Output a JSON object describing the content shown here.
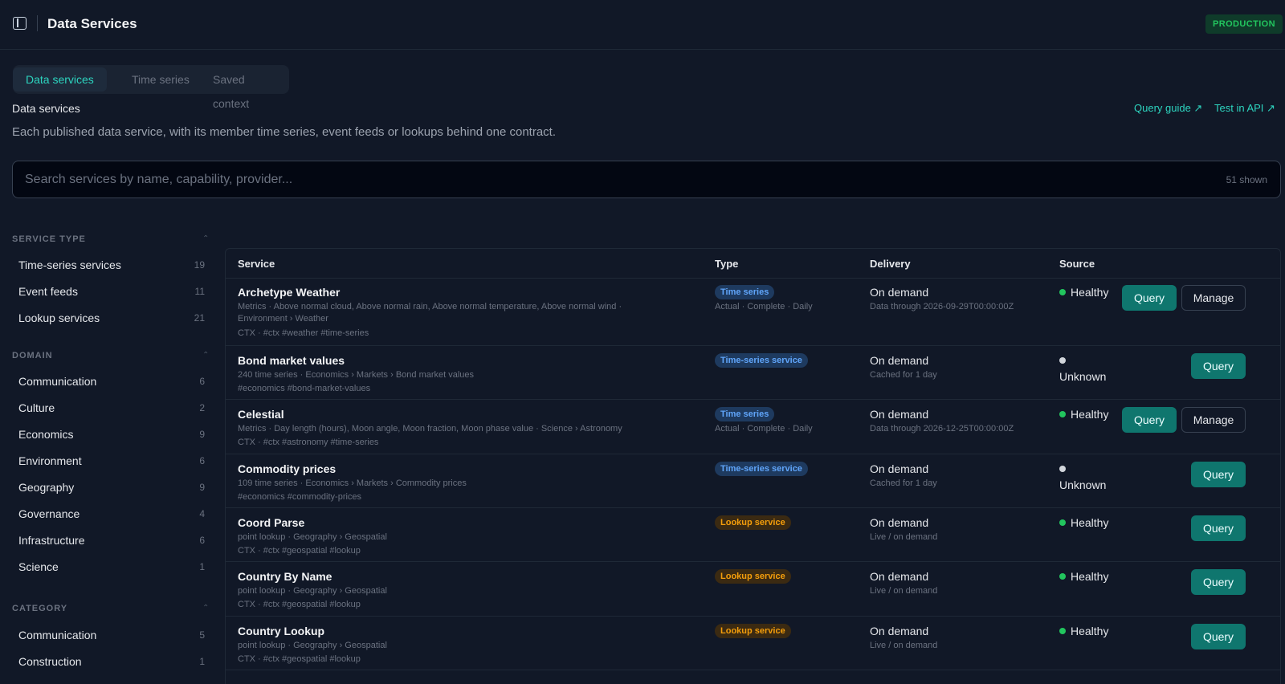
{
  "header": {
    "title": "Data Services",
    "environment": "PRODUCTION"
  },
  "tabs": [
    {
      "label": "Data services",
      "active": true
    },
    {
      "label": "Time series",
      "active": false
    },
    {
      "label": "Saved context",
      "active": false
    }
  ],
  "section": {
    "title": "Data services",
    "description": "Each published data service, with its member time series, event feeds or lookups behind one contract."
  },
  "links": {
    "query_guide": "Query guide ↗",
    "test_api": "Test in API ↗"
  },
  "search": {
    "placeholder": "Search services by name, capability, provider...",
    "count": "51 shown"
  },
  "filters": {
    "service_type": {
      "title": "SERVICE TYPE",
      "items": [
        {
          "label": "Time-series services",
          "count": "19"
        },
        {
          "label": "Event feeds",
          "count": "11"
        },
        {
          "label": "Lookup services",
          "count": "21"
        }
      ]
    },
    "domain": {
      "title": "DOMAIN",
      "items": [
        {
          "label": "Communication",
          "count": "6"
        },
        {
          "label": "Culture",
          "count": "2"
        },
        {
          "label": "Economics",
          "count": "9"
        },
        {
          "label": "Environment",
          "count": "6"
        },
        {
          "label": "Geography",
          "count": "9"
        },
        {
          "label": "Governance",
          "count": "4"
        },
        {
          "label": "Infrastructure",
          "count": "6"
        },
        {
          "label": "Science",
          "count": "1"
        }
      ]
    },
    "category": {
      "title": "CATEGORY",
      "items": [
        {
          "label": "Communication",
          "count": "5"
        },
        {
          "label": "Construction",
          "count": "1"
        }
      ]
    }
  },
  "table": {
    "columns": [
      "Service",
      "Type",
      "Delivery",
      "Source"
    ],
    "query_label": "Query",
    "manage_label": "Manage",
    "rows": [
      {
        "name": "Archetype Weather",
        "meta": "Metrics · Above normal cloud, Above normal rain, Above normal temperature, Above normal wind ·",
        "meta2": "Environment › Weather",
        "tags": "CTX · #ctx #weather #time-series",
        "type_badge": "Time series",
        "type_sub": "Actual · Complete · Daily",
        "delivery": "On demand",
        "delivery_sub": "Data through 2026-09-29T00:00:00Z",
        "status_word": "Healthy",
        "status_detail": ""
      },
      {
        "name": "Bond market values",
        "meta": "240 time series · Economics › Markets › Bond market values",
        "meta2": "",
        "tags": "#economics #bond-market-values",
        "type_badge": "Time-series service",
        "type_sub": "",
        "delivery": "On demand",
        "delivery_sub": "Cached for 1 day",
        "status_word": "",
        "status_detail": "Unknown"
      },
      {
        "name": "Celestial",
        "meta": "Metrics · Day length (hours), Moon angle, Moon fraction, Moon phase value · Science › Astronomy",
        "meta2": "",
        "tags": "CTX · #ctx #astronomy #time-series",
        "type_badge": "Time series",
        "type_sub": "Actual · Complete · Daily",
        "delivery": "On demand",
        "delivery_sub": "Data through 2026-12-25T00:00:00Z",
        "status_word": "Healthy",
        "status_detail": ""
      },
      {
        "name": "Commodity prices",
        "meta": "109 time series · Economics › Markets › Commodity prices",
        "meta2": "",
        "tags": "#economics #commodity-prices",
        "type_badge": "Time-series service",
        "type_sub": "",
        "delivery": "On demand",
        "delivery_sub": "Cached for 1 day",
        "status_word": "",
        "status_detail": "Unknown"
      },
      {
        "name": "Coord Parse",
        "meta": "point lookup · Geography › Geospatial",
        "meta2": "",
        "tags": "CTX · #ctx #geospatial #lookup",
        "type_badge": "Lookup service",
        "type_sub": "",
        "delivery": "On demand",
        "delivery_sub": "Live / on demand",
        "status_word": "Healthy",
        "status_detail": ""
      },
      {
        "name": "Country By Name",
        "meta": "point lookup · Geography › Geospatial",
        "meta2": "",
        "tags": "CTX · #ctx #geospatial #lookup",
        "type_badge": "Lookup service",
        "type_sub": "",
        "delivery": "On demand",
        "delivery_sub": "Live / on demand",
        "status_word": "Healthy",
        "status_detail": ""
      },
      {
        "name": "Country Lookup",
        "meta": "point lookup · Geography › Geospatial",
        "meta2": "",
        "tags": "CTX · #ctx #geospatial #lookup",
        "type_badge": "Lookup service",
        "type_sub": "",
        "delivery": "On demand",
        "delivery_sub": "Live / on demand",
        "status_word": "Healthy",
        "status_detail": ""
      }
    ]
  }
}
